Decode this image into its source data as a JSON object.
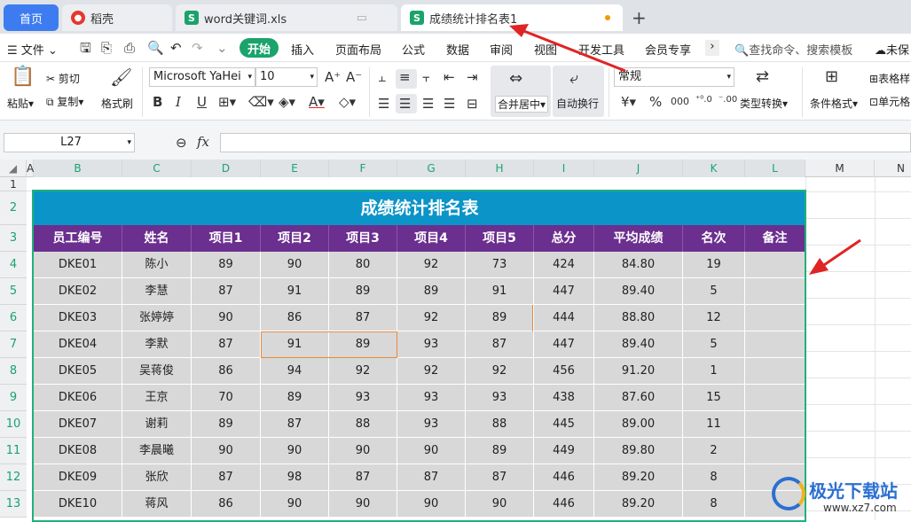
{
  "tabs": {
    "home": "首页",
    "wps": "稻壳",
    "file1": "word关键词.xls",
    "active": "成绩统计排名表1"
  },
  "menu": {
    "file": "文件",
    "items": [
      "开始",
      "插入",
      "页面布局",
      "公式",
      "数据",
      "审阅",
      "视图",
      "开发工具",
      "会员专享"
    ],
    "search_placeholder": "查找命令、搜索模板",
    "sync": "未保"
  },
  "ribbon": {
    "paste": "粘贴",
    "cut": "剪切",
    "copy": "复制",
    "format_painter": "格式刷",
    "font_name": "Microsoft YaHei",
    "font_size": "10",
    "merge_center": "合并居中",
    "wrap_text": "自动换行",
    "number_format": "常规",
    "type_convert": "类型转换",
    "cond_format": "条件格式",
    "table_style": "表格样",
    "cell_style": "单元格"
  },
  "formula_bar": {
    "name_box": "L27",
    "fx": "fx",
    "value": ""
  },
  "columns": [
    "A",
    "B",
    "C",
    "D",
    "E",
    "F",
    "G",
    "H",
    "I",
    "J",
    "K",
    "L",
    "M",
    "N"
  ],
  "rows": [
    "1",
    "2",
    "3",
    "4",
    "5",
    "6",
    "7",
    "8",
    "9",
    "10",
    "11",
    "12",
    "13"
  ],
  "sheet": {
    "title": "成绩统计排名表",
    "headers": [
      "员工编号",
      "姓名",
      "项目1",
      "项目2",
      "项目3",
      "项目4",
      "项目5",
      "总分",
      "平均成绩",
      "名次",
      "备注"
    ],
    "data": [
      [
        "DKE01",
        "陈小",
        "89",
        "90",
        "80",
        "92",
        "73",
        "424",
        "84.80",
        "19",
        ""
      ],
      [
        "DKE02",
        "李慧",
        "87",
        "91",
        "89",
        "89",
        "91",
        "447",
        "89.40",
        "5",
        ""
      ],
      [
        "DKE03",
        "张婷婷",
        "90",
        "86",
        "87",
        "92",
        "89",
        "444",
        "88.80",
        "12",
        ""
      ],
      [
        "DKE04",
        "李默",
        "87",
        "91",
        "89",
        "93",
        "87",
        "447",
        "89.40",
        "5",
        ""
      ],
      [
        "DKE05",
        "吴蒋俊",
        "86",
        "94",
        "92",
        "92",
        "92",
        "456",
        "91.20",
        "1",
        ""
      ],
      [
        "DKE06",
        "王京",
        "70",
        "89",
        "93",
        "93",
        "93",
        "438",
        "87.60",
        "15",
        ""
      ],
      [
        "DKE07",
        "谢莉",
        "89",
        "87",
        "88",
        "93",
        "88",
        "445",
        "89.00",
        "11",
        ""
      ],
      [
        "DKE08",
        "李晨曦",
        "90",
        "90",
        "90",
        "90",
        "89",
        "449",
        "89.80",
        "2",
        ""
      ],
      [
        "DKE09",
        "张欣",
        "87",
        "98",
        "87",
        "87",
        "87",
        "446",
        "89.20",
        "8",
        ""
      ],
      [
        "DKE10",
        "蒋风",
        "86",
        "90",
        "90",
        "90",
        "90",
        "446",
        "89.20",
        "8",
        ""
      ]
    ]
  },
  "watermark": "极光下载站",
  "watermark_url": "www.xz7.com",
  "colors": {
    "title_bg": "#0b94c8",
    "header_bg": "#6b2f8f",
    "cell_bg": "#d8d8d8",
    "border": "#22b07a",
    "arrow": "#e02424",
    "start_btn": "#1aa36b"
  }
}
